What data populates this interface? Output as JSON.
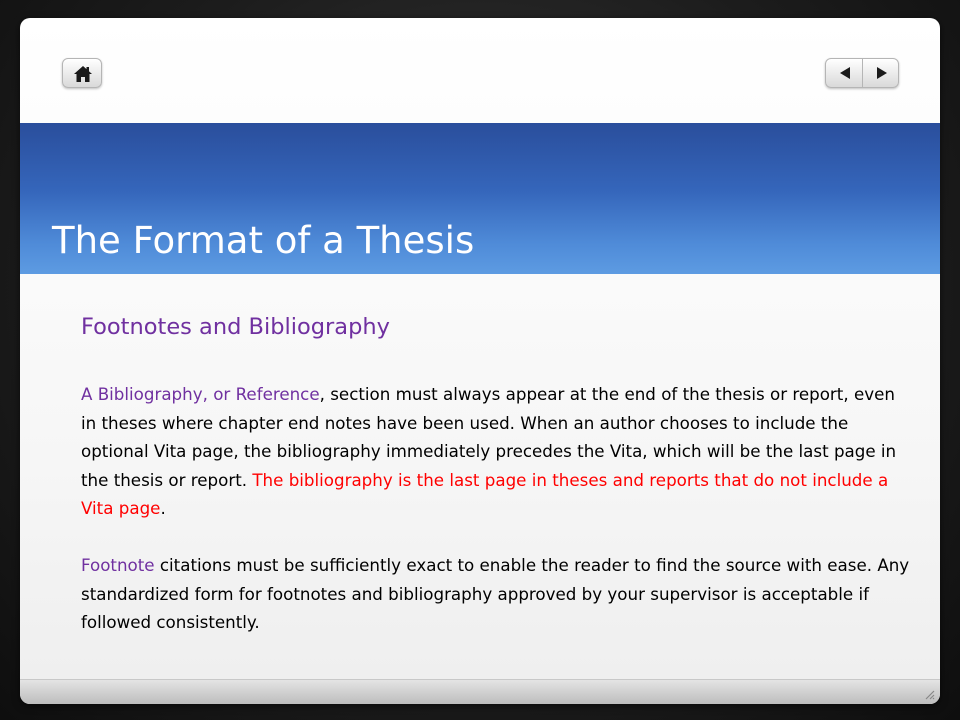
{
  "nav": {
    "home_icon": "home-icon",
    "prev_icon": "triangle-left-icon",
    "next_icon": "triangle-right-icon"
  },
  "header": {
    "title": "The Format of a Thesis"
  },
  "content": {
    "subtitle": "Footnotes and Bibliography",
    "paragraph1": {
      "part1_purple": "A Bibliography, or Reference",
      "part2": ", section must always appear at the end of the thesis or report, even in theses where chapter end notes have been used. When an author chooses to include the optional Vita page, the bibliography immediately precedes the Vita, which will be the last page in the thesis or report. ",
      "part3_red": "The bibliography is the last page in theses and reports that do not include a Vita page",
      "part4": "."
    },
    "paragraph2": {
      "part1_purple": "Footnote",
      "part2": " citations must be sufficiently exact to enable the reader to find the source with ease. Any standardized form for footnotes and bibliography approved by your supervisor is acceptable if followed consistently."
    }
  },
  "colors": {
    "title_band": "#3566bb",
    "purple_text": "#7030a0",
    "red_text": "#ff0000"
  }
}
